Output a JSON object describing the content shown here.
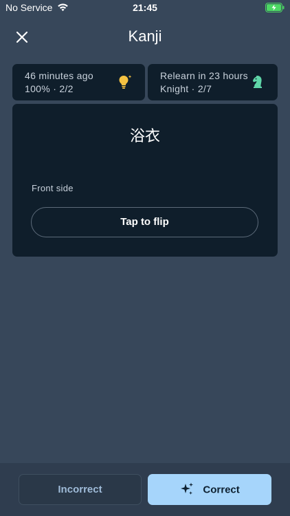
{
  "status_bar": {
    "carrier": "No Service",
    "time": "21:45",
    "icons": [
      "wifi-icon",
      "battery-charging-icon"
    ]
  },
  "header": {
    "title": "Kanji",
    "close_icon": "close-icon"
  },
  "info_cards": [
    {
      "line1": "46 minutes ago",
      "line2": "100% · 2/2",
      "icon": "lightbulb-icon",
      "icon_color": "#f5c242"
    },
    {
      "line1": "Relearn in 23 hours",
      "line2": "Knight · 2/7",
      "icon": "chess-knight-icon",
      "icon_color": "#5fd6a8"
    }
  ],
  "card": {
    "term": "浴衣",
    "side_label": "Front side",
    "flip_label": "Tap to flip"
  },
  "actions": {
    "incorrect_label": "Incorrect",
    "correct_label": "Correct",
    "correct_icon": "sparkle-icon"
  },
  "colors": {
    "background": "#37475a",
    "card": "#0f1e2b",
    "accent": "#a6d5fb",
    "battery": "#4cd964"
  }
}
